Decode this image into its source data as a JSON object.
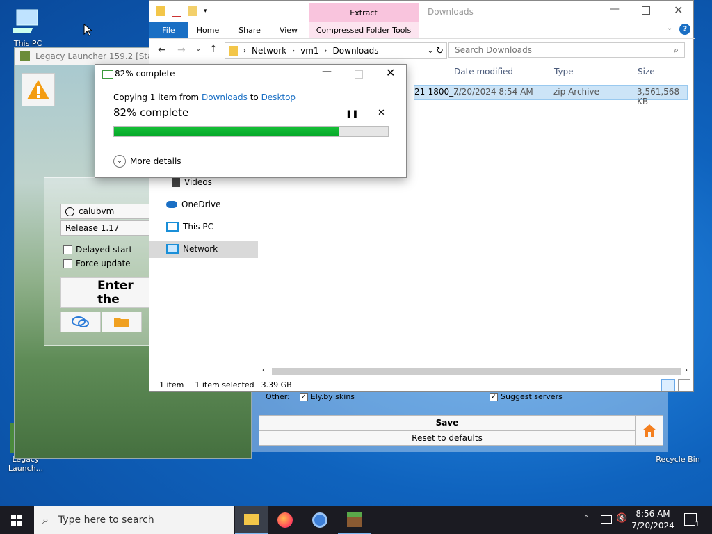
{
  "desktop": {
    "icons": [
      {
        "label": "This PC"
      },
      {
        "label": "Legacy Launch..."
      },
      {
        "label": "Recycle Bin"
      }
    ]
  },
  "launcher": {
    "title": "Legacy Launcher 159.2 [Stable]",
    "username": "calubvm",
    "version": "Release 1.17",
    "delayed_start": "Delayed start",
    "force_update": "Force update",
    "enter_button": "Enter the",
    "other_label": "Other:",
    "ely_skins": "Ely.by skins",
    "suggest_servers": "Suggest servers",
    "save_label": "Save",
    "reset_label": "Reset to defaults"
  },
  "explorer": {
    "title": "Downloads",
    "extract_tab": "Extract",
    "compressed_tools_tab": "Compressed Folder Tools",
    "tabs": [
      "File",
      "Home",
      "Share",
      "View"
    ],
    "breadcrumb": [
      "Network",
      "vm1",
      "Downloads"
    ],
    "search_placeholder": "Search Downloads",
    "columns": {
      "date": "Date modified",
      "type": "Type",
      "size": "Size"
    },
    "file_row": {
      "name": "21-1800_...",
      "date": "7/20/2024 8:54 AM",
      "type": "zip Archive",
      "size": "3,561,568 KB"
    },
    "nav": [
      {
        "label": "Videos"
      },
      {
        "label": "OneDrive"
      },
      {
        "label": "This PC"
      },
      {
        "label": "Network"
      }
    ],
    "status": {
      "count": "1 item",
      "selected": "1 item selected",
      "size": "3.39 GB"
    }
  },
  "copy_dialog": {
    "title": "82% complete",
    "copy_prefix": "Copying 1 item from",
    "source": "Downloads",
    "to": "to",
    "dest": "Desktop",
    "percent_text": "82% complete",
    "progress": 0.82,
    "more_details": "More details"
  },
  "taskbar": {
    "search_placeholder": "Type here to search",
    "time": "8:56 AM",
    "date": "7/20/2024",
    "notification_count": "1"
  }
}
